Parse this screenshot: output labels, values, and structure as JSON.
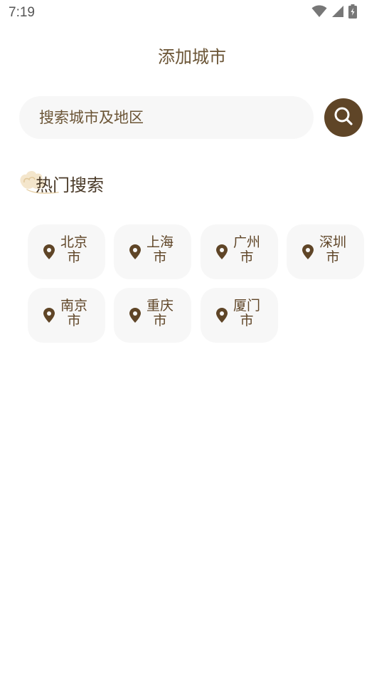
{
  "status_bar": {
    "time": "7:19",
    "icons": [
      "wifi-icon",
      "cellular-signal-icon",
      "battery-charging-icon"
    ]
  },
  "header": {
    "title": "添加城市"
  },
  "search": {
    "placeholder": "搜索城市及地区",
    "value": "",
    "button_icon": "search-icon"
  },
  "hot_search": {
    "title": "热门搜索",
    "cities": [
      {
        "name": "北京市"
      },
      {
        "name": "上海市"
      },
      {
        "name": "广州市"
      },
      {
        "name": "深圳市"
      },
      {
        "name": "南京市"
      },
      {
        "name": "重庆市"
      },
      {
        "name": "厦门市"
      }
    ]
  },
  "colors": {
    "accent": "#5f4527",
    "chip_background": "#f7f7f7",
    "text": "#5a4630"
  }
}
